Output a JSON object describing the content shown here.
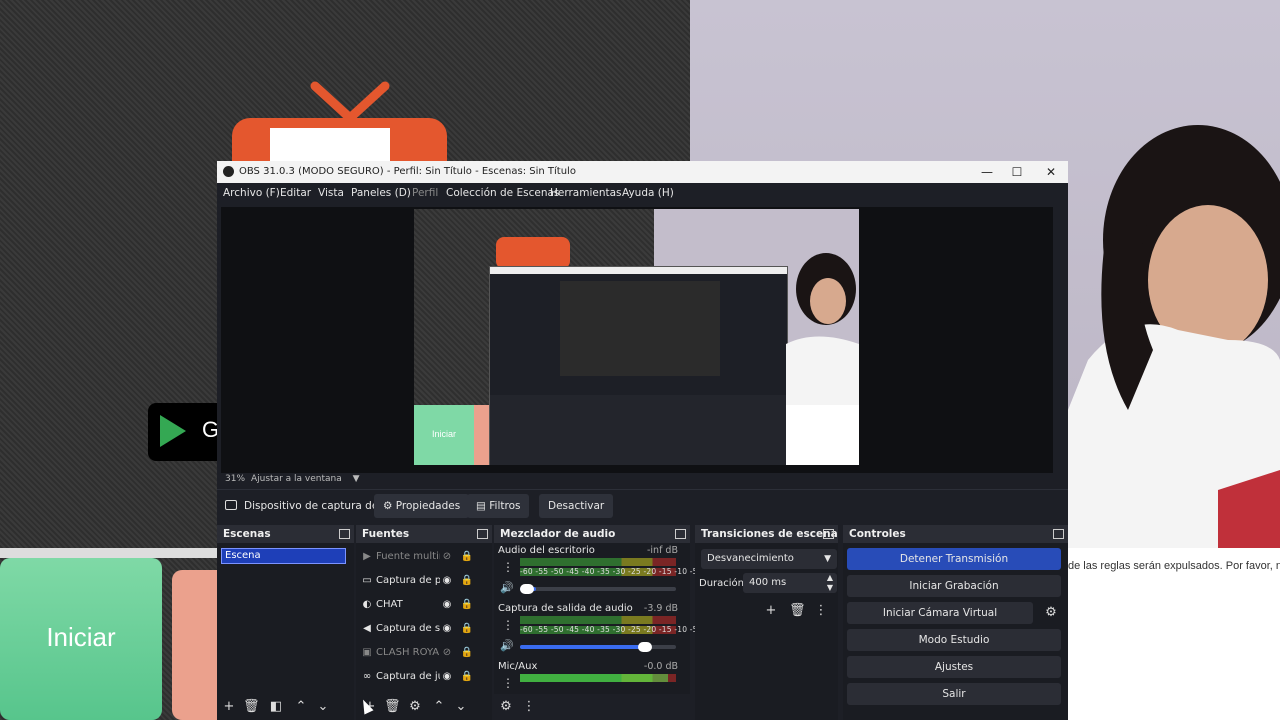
{
  "background": {
    "green_card_label": "Iniciar",
    "chat_text": "de las reglas serán expulsados. Por favor, n",
    "store_badge_text": "G"
  },
  "window": {
    "title": "OBS 31.0.3 (MODO SEGURO) - Perfil: Sin Título - Escenas: Sin Título",
    "minimize": "—",
    "maximize": "☐",
    "close": "✕"
  },
  "menu": {
    "items": [
      "Archivo (F)",
      "Editar",
      "Vista",
      "Paneles (D)",
      "Perfil",
      "Colección de Escenas",
      "Herramientas",
      "Ayuda (H)"
    ]
  },
  "preview": {
    "nested_button": "Iniciar",
    "zoom_percent": "31%",
    "zoom_mode": "Ajustar a la ventana"
  },
  "source_toolbar": {
    "device": "Dispositivo de captura de v",
    "properties": "Propiedades",
    "filters": "Filtros",
    "deactivate": "Desactivar"
  },
  "scenes": {
    "title": "Escenas",
    "items": [
      "Escena"
    ]
  },
  "sources": {
    "title": "Fuentes",
    "items": [
      {
        "name": "Fuente multin",
        "icon": "play-icon",
        "visible": false
      },
      {
        "name": "Captura de pa",
        "icon": "window-icon",
        "visible": true
      },
      {
        "name": "CHAT",
        "icon": "globe-icon",
        "visible": true
      },
      {
        "name": "Captura de sa",
        "icon": "speaker-icon",
        "visible": true
      },
      {
        "name": "CLASH ROYAL",
        "icon": "image-icon",
        "visible": false
      },
      {
        "name": "Captura de ju",
        "icon": "gamepad-icon",
        "visible": true
      }
    ]
  },
  "mixer": {
    "title": "Mezclador de audio",
    "scale": "-60 -55 -50 -45 -40 -35 -30 -25 -20 -15 -10 -5 0",
    "channels": [
      {
        "name": "Audio del escritorio",
        "db": "-inf dB",
        "level": 0.0,
        "volume": 0.1
      },
      {
        "name": "Captura de salida de audio",
        "db": "-3.9 dB",
        "level": 0.0,
        "volume": 0.8
      },
      {
        "name": "Mic/Aux",
        "db": "-0.0 dB",
        "level": 0.95,
        "volume": 1.0
      }
    ]
  },
  "transitions": {
    "title": "Transiciones de escena",
    "selected": "Desvanecimiento",
    "duration_label": "Duración",
    "duration_value": "400 ms"
  },
  "controls": {
    "title": "Controles",
    "stop_stream": "Detener Transmisión",
    "start_recording": "Iniciar Grabación",
    "start_virtualcam": "Iniciar Cámara Virtual",
    "studio_mode": "Modo Estudio",
    "settings": "Ajustes",
    "exit": "Salir"
  },
  "colors": {
    "active_button": "#284cb8",
    "dock_bg": "#1d1f26",
    "meter_green": "#2f6f2f"
  }
}
